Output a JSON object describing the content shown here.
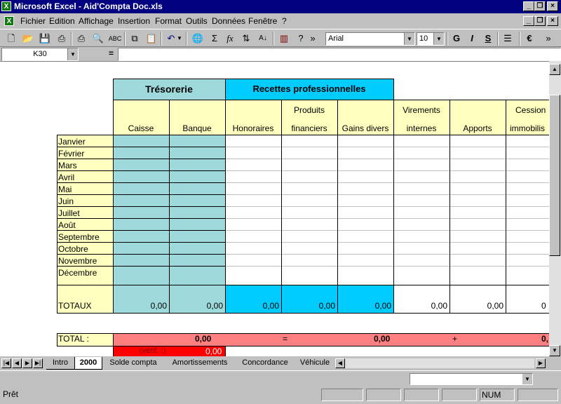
{
  "window": {
    "title": "Microsoft Excel - Aid'Compta Doc.xls",
    "icon": "excel-icon"
  },
  "menu": {
    "items": [
      "Fichier",
      "Edition",
      "Affichage",
      "Insertion",
      "Format",
      "Outils",
      "Données",
      "Fenêtre",
      "?"
    ]
  },
  "toolbar": {
    "font_name": "Arial",
    "font_size": "10",
    "bold_label": "G",
    "italic_label": "I",
    "underline_label": "S",
    "euro_label": "€",
    "sigma_label": "Σ",
    "fx_label": "fx",
    "more_label": "»"
  },
  "formula_bar": {
    "name_box": "K30",
    "equals": "=",
    "content": ""
  },
  "sheet": {
    "tresorerie_title": "Trésorerie",
    "recettes_title": "Recettes professionnelles",
    "columns": [
      {
        "line1": "",
        "line2": "Caisse"
      },
      {
        "line1": "",
        "line2": "Banque"
      },
      {
        "line1": "",
        "line2": "Honoraires"
      },
      {
        "line1": "Produits",
        "line2": "financiers"
      },
      {
        "line1": "",
        "line2": "Gains divers"
      },
      {
        "line1": "Virements",
        "line2": "internes"
      },
      {
        "line1": "",
        "line2": "Apports"
      },
      {
        "line1": "Cession",
        "line2": "immobilis"
      }
    ],
    "months": [
      "Janvier",
      "Février",
      "Mars",
      "Avril",
      "Mai",
      "Juin",
      "Juillet",
      "Août",
      "Septembre",
      "Octobre",
      "Novembre",
      "Décembre"
    ],
    "totaux_label": "TOTAUX",
    "totaux_values": [
      "0,00",
      "0,00",
      "0,00",
      "0,00",
      "0,00",
      "0,00",
      "0,00",
      "0"
    ],
    "total_label": "TOTAL :",
    "total_value_1": "0,00",
    "total_equals": "=",
    "total_value_2": "0,00",
    "total_plus": "+",
    "total_value_3": "0,",
    "verif_label": "(vérif. :)",
    "verif_value": "0,00"
  },
  "tabs": {
    "items": [
      "Intro",
      "2000",
      "Solde compta",
      "Amortissements",
      "Concordance",
      "Véhicule"
    ],
    "active": "2000"
  },
  "status": {
    "text": "Prêt",
    "num": "NUM"
  },
  "colors": {
    "title_bar": "#000080",
    "header_yellow": "#ffffc0",
    "tresorerie_teal": "#9ed9dc",
    "recettes_cyan": "#00ccff",
    "total_salmon": "#ff8080",
    "verif_red": "#ff0000"
  }
}
